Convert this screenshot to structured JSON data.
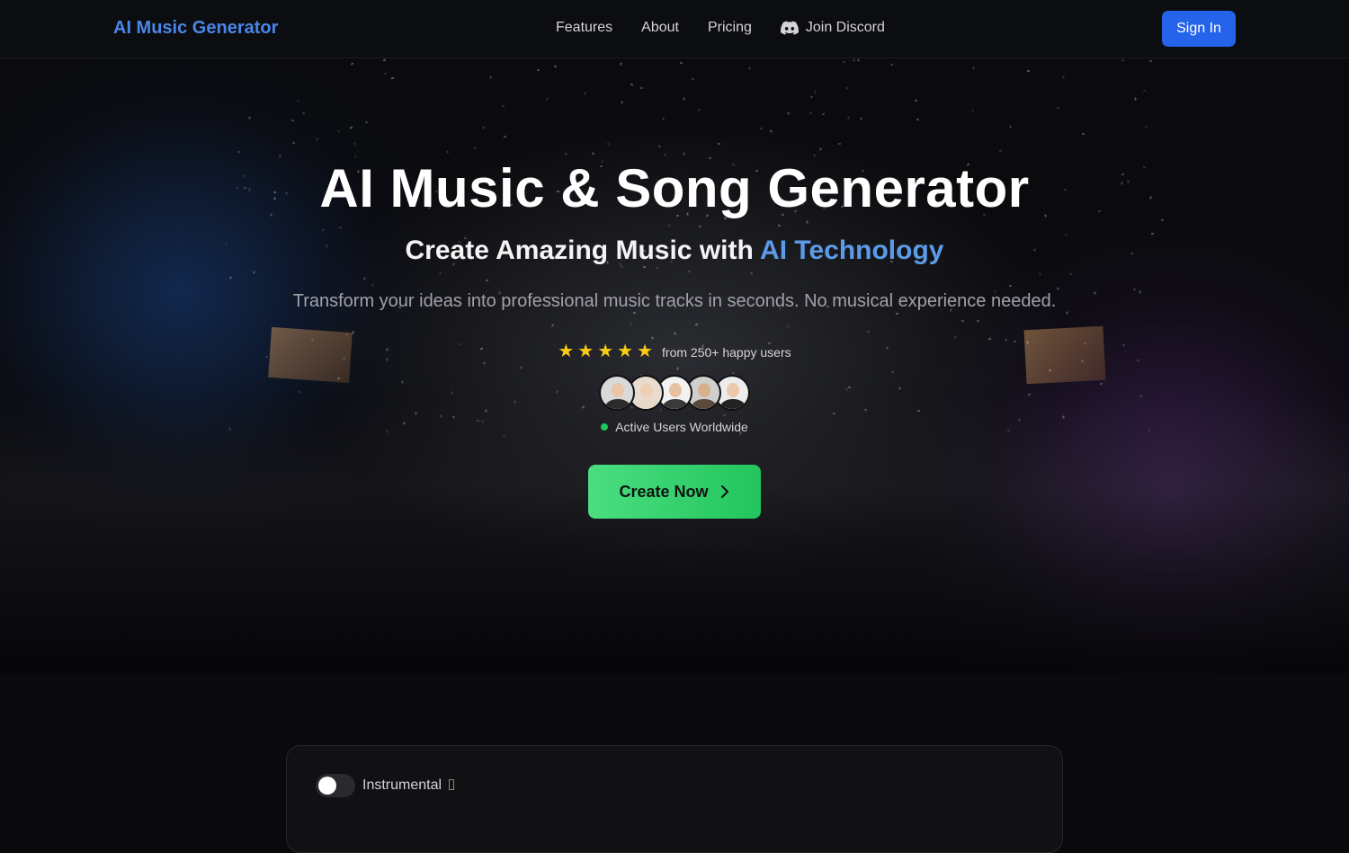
{
  "nav": {
    "brand": "AI Music Generator",
    "links": [
      "Features",
      "About",
      "Pricing"
    ],
    "discord_label": "Join Discord",
    "sign_in": "Sign In"
  },
  "hero": {
    "title": "AI Music & Song Generator",
    "subtitle_prefix": "Create Amazing Music with ",
    "subtitle_accent": "AI Technology",
    "description": "Transform your ideas into professional music tracks in seconds. No musical experience needed.",
    "rating": {
      "stars": 5,
      "star_glyph": "★",
      "text": "from 250+ happy users"
    },
    "avatars": [
      {
        "skin": "#e8c6a8",
        "shirt": "#2b2b2b",
        "bg": "#d9d9d9"
      },
      {
        "skin": "#f0d0b4",
        "shirt": "#e6d8c8",
        "bg": "#e8dcd0"
      },
      {
        "skin": "#e6c0a0",
        "shirt": "#3a3a3a",
        "bg": "#f2f2f2"
      },
      {
        "skin": "#d9b08c",
        "shirt": "#5a4a3c",
        "bg": "#cfcfcf"
      },
      {
        "skin": "#ecc8aa",
        "shirt": "#222222",
        "bg": "#ececec"
      }
    ],
    "active_label": "Active Users Worldwide",
    "cta_label": "Create Now"
  },
  "generator": {
    "instrumental_label": "Instrumental",
    "instrumental_on": false
  },
  "colors": {
    "brand": "#4a86e8",
    "accent": "#5b9be8",
    "primary_button": "#2563eb",
    "cta_start": "#4ade80",
    "cta_end": "#22c55e",
    "star": "#facc15",
    "online_dot": "#22c55e"
  }
}
